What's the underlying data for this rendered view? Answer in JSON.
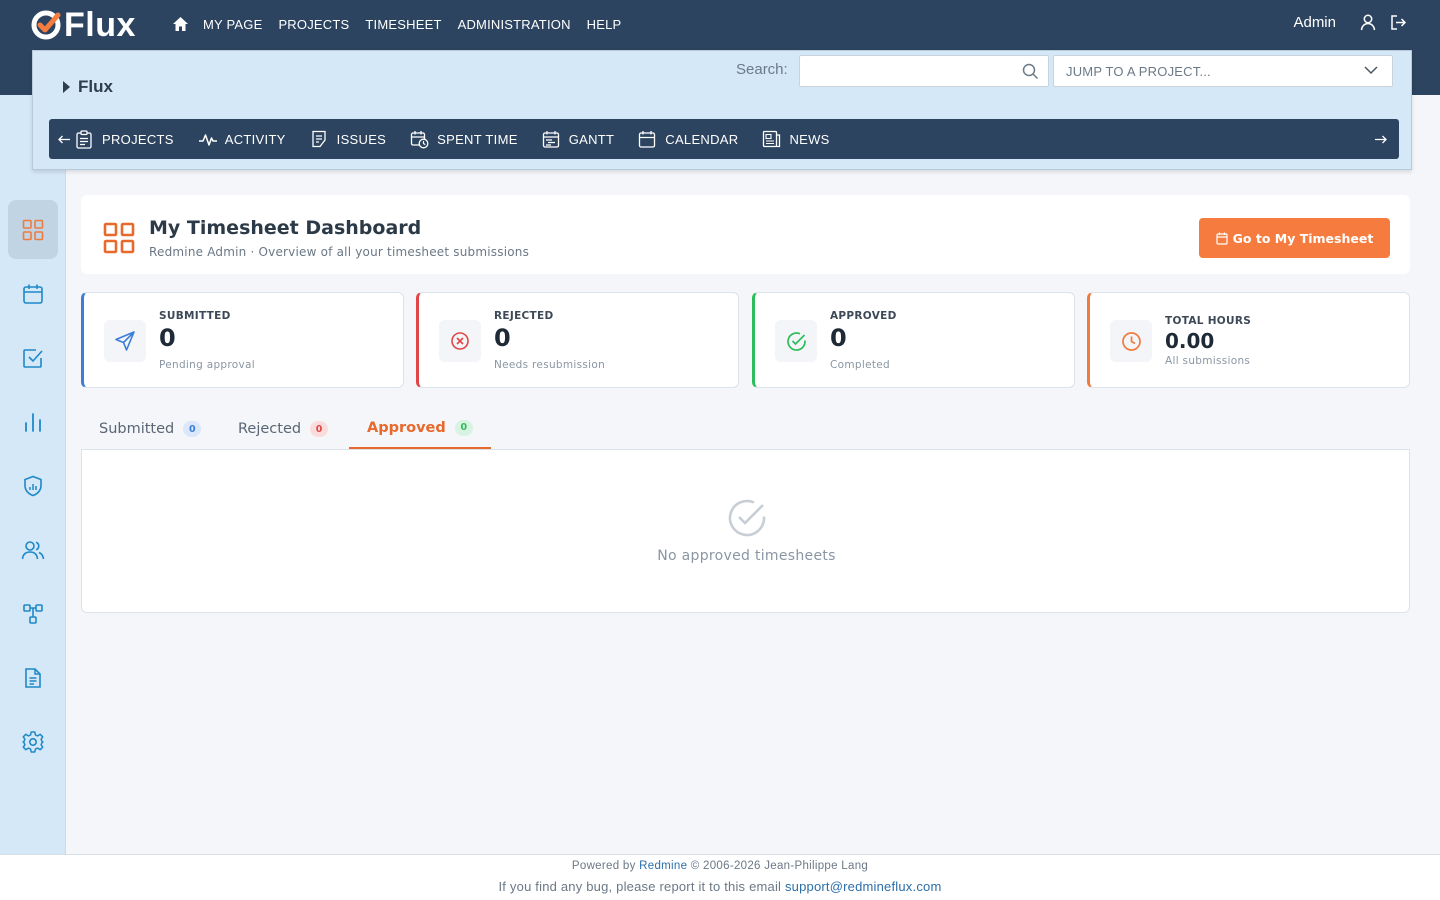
{
  "app": {
    "name": "Flux"
  },
  "top_nav": {
    "items": [
      "MY PAGE",
      "PROJECTS",
      "TIMESHEET",
      "ADMINISTRATION",
      "HELP"
    ]
  },
  "user": {
    "name": "Admin"
  },
  "project": {
    "title": "Flux"
  },
  "search": {
    "label": "Search:",
    "placeholder": ""
  },
  "jump": {
    "placeholder": "JUMP TO A PROJECT..."
  },
  "project_menu": {
    "items": [
      "PROJECTS",
      "ACTIVITY",
      "ISSUES",
      "SPENT TIME",
      "GANTT",
      "CALENDAR",
      "NEWS"
    ]
  },
  "sidebar": {
    "items": [
      "grid-icon",
      "calendar-icon",
      "checkbox-icon",
      "bar-chart-icon",
      "shield-icon",
      "users-icon",
      "workflow-icon",
      "document-icon",
      "gear-icon"
    ]
  },
  "dashboard": {
    "title": "My Timesheet Dashboard",
    "subtitle": "Redmine Admin · Overview of all your timesheet submissions",
    "button": "Go to My Timesheet"
  },
  "stats": [
    {
      "label": "SUBMITTED",
      "value": "0",
      "note": "Pending approval",
      "color": "#3b7dd8"
    },
    {
      "label": "REJECTED",
      "value": "0",
      "note": "Needs resubmission",
      "color": "#e04646"
    },
    {
      "label": "APPROVED",
      "value": "0",
      "note": "Completed",
      "color": "#2fbd5c"
    },
    {
      "label": "TOTAL HOURS",
      "value": "0.00",
      "note": "All submissions",
      "color": "#f07b3f"
    }
  ],
  "tabs": [
    {
      "label": "Submitted",
      "count": "0"
    },
    {
      "label": "Rejected",
      "count": "0"
    },
    {
      "label": "Approved",
      "count": "0"
    }
  ],
  "empty": {
    "text": "No approved timesheets"
  },
  "footer": {
    "powered_prefix": "Powered by",
    "powered_link": "Redmine",
    "powered_suffix": "© 2006-2026 Jean-Philippe Lang",
    "bug_text": "If you find any bug, please report it to this email",
    "bug_email": "support@redmineflux.com"
  },
  "colors": {
    "brand_dark": "#2c4460",
    "accent": "#f57c3e",
    "panel": "#d4e8f7"
  }
}
